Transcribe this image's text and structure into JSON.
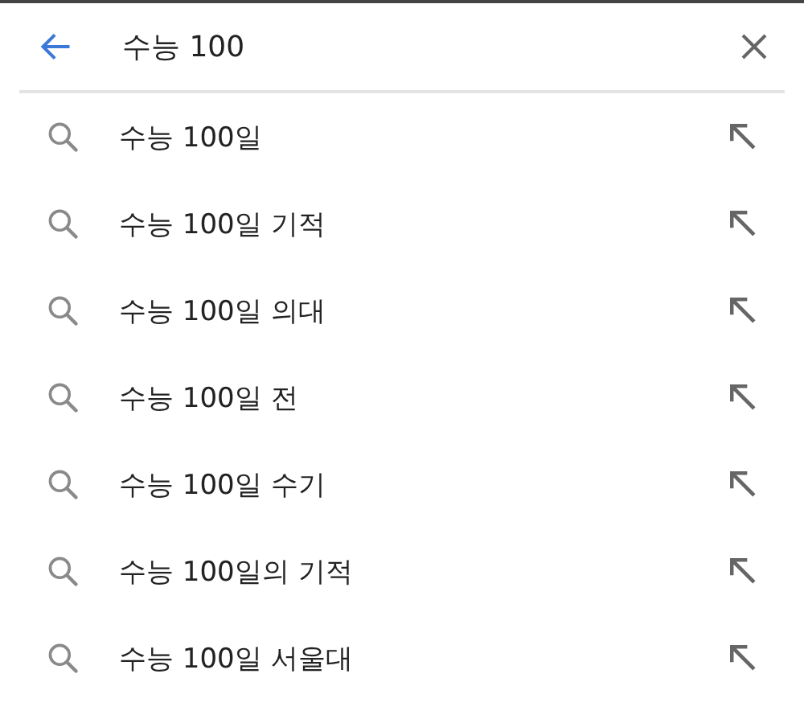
{
  "search": {
    "value": "수능 100"
  },
  "suggestions": [
    {
      "text": "수능 100일"
    },
    {
      "text": "수능 100일 기적"
    },
    {
      "text": "수능 100일 의대"
    },
    {
      "text": "수능 100일 전"
    },
    {
      "text": "수능 100일 수기"
    },
    {
      "text": "수능 100일의 기적"
    },
    {
      "text": "수능 100일 서울대"
    }
  ]
}
